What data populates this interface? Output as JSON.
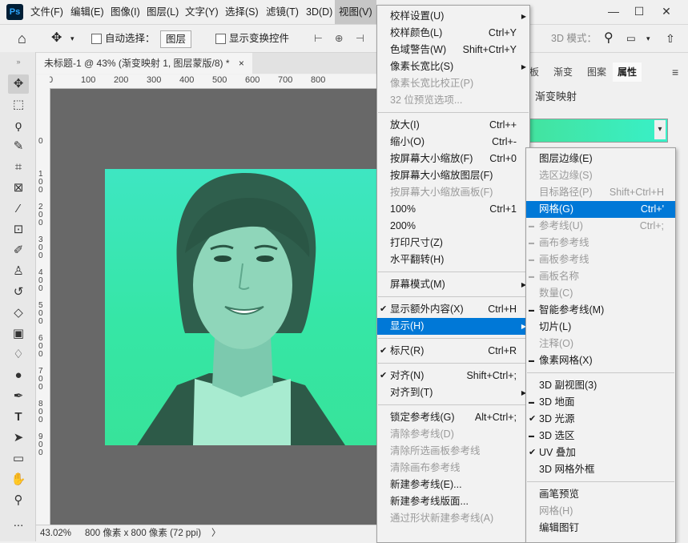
{
  "app": {
    "logo": "Ps"
  },
  "menubar": {
    "items": [
      "文件(F)",
      "编辑(E)",
      "图像(I)",
      "图层(L)",
      "文字(Y)",
      "选择(S)",
      "滤镜(T)",
      "3D(D)",
      "视图(V)"
    ],
    "active": "视图(V)",
    "window_buttons": [
      "—",
      "☐",
      "✕"
    ]
  },
  "options_bar": {
    "home_icon": "home-icon",
    "move_icon": "move-icon",
    "auto_select_label": "自动选择：",
    "auto_select_value": "图层",
    "show_transform_label": "显示变换控件",
    "mode_3d_label": "3D 模式：",
    "more": "..."
  },
  "document": {
    "tab_title": "未标题-1 @ 43% (渐变映射 1, 图层蒙版/8) *",
    "close": "×",
    "ruler_top": [
      "0",
      "100",
      "200",
      "300",
      "400",
      "500",
      "600",
      "700",
      "800"
    ],
    "ruler_left": [
      "0",
      "1 0 0",
      "2 0 0",
      "3 0 0",
      "4 0 0",
      "5 0 0",
      "6 0 0",
      "7 0 0",
      "8 0 0",
      "9 0 0"
    ]
  },
  "statusbar": {
    "zoom": "43.02%",
    "info": "800 像素 x 800 像素 (72 ppi)",
    "arrow": "〉"
  },
  "panels": {
    "tabs": [
      "板",
      "渐变",
      "图案",
      "属性"
    ],
    "active_tab": "属性",
    "gradient_map_label": "渐变映射",
    "gradient_colors": [
      "#43e39f",
      "#38f0c8"
    ]
  },
  "view_menu": {
    "items": [
      {
        "label": "校样设置(U)",
        "submenu": true
      },
      {
        "label": "校样颜色(L)",
        "shortcut": "Ctrl+Y"
      },
      {
        "label": "色域警告(W)",
        "shortcut": "Shift+Ctrl+Y"
      },
      {
        "label": "像素长宽比(S)",
        "submenu": true
      },
      {
        "label": "像素长宽比校正(P)",
        "disabled": true
      },
      {
        "label": "32 位预览选项...",
        "disabled": true
      },
      {
        "separator": true
      },
      {
        "label": "放大(I)",
        "shortcut": "Ctrl++"
      },
      {
        "label": "缩小(O)",
        "shortcut": "Ctrl+-"
      },
      {
        "label": "按屏幕大小缩放(F)",
        "shortcut": "Ctrl+0"
      },
      {
        "label": "按屏幕大小缩放图层(F)"
      },
      {
        "label": "按屏幕大小缩放画板(F)",
        "disabled": true
      },
      {
        "label": "100%",
        "shortcut": "Ctrl+1"
      },
      {
        "label": "200%"
      },
      {
        "label": "打印尺寸(Z)"
      },
      {
        "label": "水平翻转(H)"
      },
      {
        "separator": true
      },
      {
        "label": "屏幕模式(M)",
        "submenu": true
      },
      {
        "separator": true
      },
      {
        "label": "显示额外内容(X)",
        "shortcut": "Ctrl+H",
        "checked": true
      },
      {
        "label": "显示(H)",
        "submenu": true,
        "highlighted": true
      },
      {
        "separator": true
      },
      {
        "label": "标尺(R)",
        "shortcut": "Ctrl+R",
        "checked": true
      },
      {
        "separator": true
      },
      {
        "label": "对齐(N)",
        "shortcut": "Shift+Ctrl+;",
        "checked": true
      },
      {
        "label": "对齐到(T)",
        "submenu": true
      },
      {
        "separator": true
      },
      {
        "label": "锁定参考线(G)",
        "shortcut": "Alt+Ctrl+;"
      },
      {
        "label": "清除参考线(D)",
        "disabled": true
      },
      {
        "label": "清除所选画板参考线",
        "disabled": true
      },
      {
        "label": "清除画布参考线",
        "disabled": true
      },
      {
        "label": "新建参考线(E)..."
      },
      {
        "label": "新建参考线版面..."
      },
      {
        "label": "通过形状新建参考线(A)",
        "disabled": true
      }
    ]
  },
  "show_submenu": {
    "items": [
      {
        "label": "图层边缘(E)"
      },
      {
        "label": "选区边缘(S)",
        "disabled": true
      },
      {
        "label": "目标路径(P)",
        "shortcut": "Shift+Ctrl+H",
        "disabled": true
      },
      {
        "label": "网格(G)",
        "shortcut": "Ctrl+'",
        "highlighted": true
      },
      {
        "label": "参考线(U)",
        "shortcut": "Ctrl+;",
        "disabled": true,
        "dash": true
      },
      {
        "label": "画布参考线",
        "disabled": true,
        "dash": true
      },
      {
        "label": "画板参考线",
        "disabled": true,
        "dash": true
      },
      {
        "label": "画板名称",
        "disabled": true,
        "dash": true
      },
      {
        "label": "数量(C)",
        "disabled": true
      },
      {
        "label": "智能参考线(M)",
        "dash_dark": true
      },
      {
        "label": "切片(L)"
      },
      {
        "label": "注释(O)",
        "disabled": true
      },
      {
        "label": "像素网格(X)",
        "dash_dark": true
      },
      {
        "separator": true
      },
      {
        "label": "3D 副视图(3)"
      },
      {
        "label": "3D 地面",
        "dash_dark": true
      },
      {
        "label": "3D 光源",
        "checked": true
      },
      {
        "label": "3D 选区",
        "dash_dark": true
      },
      {
        "label": "UV 叠加",
        "checked": true
      },
      {
        "label": "3D 网格外框"
      },
      {
        "separator": true
      },
      {
        "label": "画笔预览"
      },
      {
        "label": "网格(H)",
        "disabled": true
      },
      {
        "label": "编辑图钉"
      }
    ]
  }
}
